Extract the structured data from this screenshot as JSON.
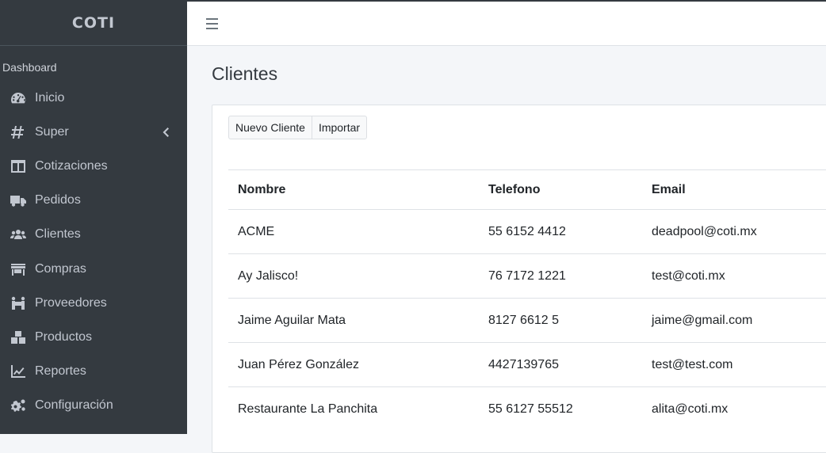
{
  "brand": {
    "name": "COTI"
  },
  "sidebar": {
    "section_header": "Dashboard",
    "items": [
      {
        "label": "Inicio",
        "icon": "dashboard-icon"
      },
      {
        "label": "Super",
        "icon": "hashtag-icon",
        "has_submenu": true
      },
      {
        "label": "Cotizaciones",
        "icon": "table-icon"
      },
      {
        "label": "Pedidos",
        "icon": "truck-icon"
      },
      {
        "label": "Clientes",
        "icon": "users-icon"
      },
      {
        "label": "Compras",
        "icon": "store-icon"
      },
      {
        "label": "Proveedores",
        "icon": "people-carry-icon"
      },
      {
        "label": "Productos",
        "icon": "boxes-icon"
      },
      {
        "label": "Reportes",
        "icon": "chart-line-icon"
      },
      {
        "label": "Configuración",
        "icon": "cogs-icon"
      }
    ]
  },
  "page": {
    "title": "Clientes"
  },
  "toolbar": {
    "new_label": "Nuevo Cliente",
    "import_label": "Importar"
  },
  "table": {
    "headers": [
      "Nombre",
      "Telefono",
      "Email"
    ],
    "rows": [
      [
        "ACME",
        "55 6152 4412",
        "deadpool@coti.mx"
      ],
      [
        "Ay Jalisco!",
        "76 7172 1221",
        "test@coti.mx"
      ],
      [
        "Jaime Aguilar Mata",
        "8127 6612 5",
        "jaime@gmail.com"
      ],
      [
        "Juan Pérez González",
        "4427139765",
        "test@test.com"
      ],
      [
        "Restaurante La Panchita",
        "55 6127 55512",
        "alita@coti.mx"
      ]
    ]
  },
  "colors": {
    "sidebar_bg": "#343a40",
    "sidebar_text": "#c2c7d0",
    "content_bg": "#f4f6f9"
  }
}
